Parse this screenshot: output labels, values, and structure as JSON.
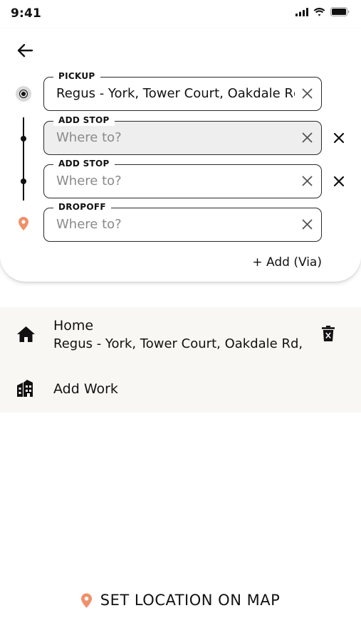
{
  "status_bar": {
    "time": "9:41",
    "icons": [
      "cellular-signal-icon",
      "wifi-icon",
      "battery-icon"
    ]
  },
  "header": {
    "back_icon": "arrow-left-icon"
  },
  "route": {
    "pickup": {
      "label": "PICKUP",
      "value": "Regus - York, Tower Court, Oakdale Rd, York"
    },
    "stops": [
      {
        "label": "ADD STOP",
        "placeholder": "Where to?",
        "value": "",
        "active": true
      },
      {
        "label": "ADD STOP",
        "placeholder": "Where to?",
        "value": "",
        "active": false
      }
    ],
    "dropoff": {
      "label": "DROPOFF",
      "placeholder": "Where to?",
      "value": ""
    },
    "add_via_label": "+ Add (Via)"
  },
  "saved_places": [
    {
      "title": "Home",
      "subtitle": "Regus - York, Tower Court, Oakdale Rd,",
      "icon": "home-icon",
      "deletable": true
    },
    {
      "title": "Add Work",
      "subtitle": "",
      "icon": "office-building-icon",
      "deletable": false
    }
  ],
  "footer": {
    "set_location_label": "SET LOCATION ON MAP",
    "icon": "map-pin-icon"
  },
  "colors": {
    "accent": "#F0906A",
    "text": "#111111",
    "placeholder": "#8A8A8A",
    "active_field_bg": "#EEEEEE",
    "saved_places_bg": "#F9F7F3"
  }
}
